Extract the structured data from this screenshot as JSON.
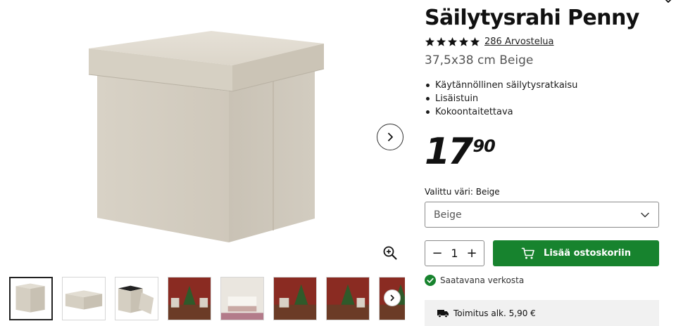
{
  "product": {
    "title": "Säilytysrahi Penny",
    "rating": {
      "stars": 5,
      "reviews_label": "286 Arvostelua"
    },
    "subtitle": "37,5x38 cm Beige",
    "features": [
      "Käytännöllinen säilytysratkaisu",
      "Lisäistuin",
      "Kokoontaitettava"
    ],
    "price": {
      "integer": "17",
      "decimals": "90"
    },
    "color": {
      "label": "Valittu väri:",
      "value": "Beige",
      "select_value": "Beige"
    },
    "quantity": {
      "minus": "−",
      "value": "1",
      "plus": "+"
    },
    "add_to_cart_label": "Lisää ostoskoriin",
    "availability_label": "Saatavana verkosta",
    "shipping_label": "Toimitus alk. 5,90 €"
  },
  "gallery": {
    "thumbnails": [
      "box-closed",
      "box-low",
      "box-open",
      "christmas-living-room",
      "white-sofa-room",
      "christmas-living-room",
      "christmas-living-room",
      "christmas-living-room"
    ],
    "active_index": 0
  },
  "colors": {
    "accent_green": "#17832e",
    "fabric": "#d9d3c7",
    "star": "#111111"
  },
  "icons": [
    "star-icon",
    "chevron-right-icon",
    "zoom-in-icon",
    "chevron-down-icon",
    "cart-icon",
    "check-circle-icon",
    "truck-icon"
  ]
}
